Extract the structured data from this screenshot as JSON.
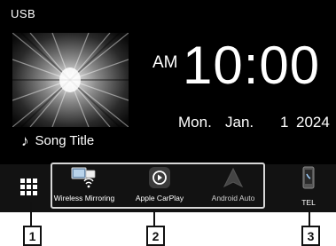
{
  "source": {
    "label": "USB"
  },
  "track": {
    "title": "Song Title",
    "note_icon": "music-note-icon"
  },
  "clock": {
    "period": "AM",
    "time": "10:00"
  },
  "date": {
    "weekday": "Mon.",
    "month": "Jan.",
    "day": "1",
    "year": "2024"
  },
  "bottom_bar": {
    "menu_icon": "grid-menu-icon",
    "apps": [
      {
        "label": "Wireless Mirroring",
        "icon": "wireless-mirroring-icon"
      },
      {
        "label": "Apple CarPlay",
        "icon": "carplay-icon"
      },
      {
        "label": "Android Auto",
        "icon": "android-auto-icon"
      }
    ],
    "tel": {
      "label": "TEL",
      "icon": "phone-icon"
    }
  },
  "callouts": [
    "1",
    "2",
    "3"
  ],
  "colors": {
    "screen_bg": "#000000",
    "bar_bg": "#121212",
    "text": "#ffffff",
    "callout_border": "#111111"
  }
}
